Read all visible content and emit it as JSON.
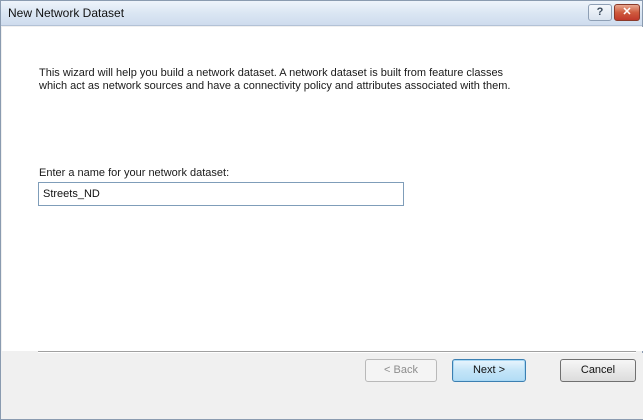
{
  "window": {
    "title": "New Network Dataset",
    "help_label": "?",
    "close_label": "✕"
  },
  "wizard": {
    "intro_text": "This wizard will help you build a network dataset.  A network dataset is built from feature classes which act as network sources and have a connectivity policy and attributes associated with them.",
    "name_label": "Enter a name for your network dataset:",
    "name_value": "Streets_ND"
  },
  "buttons": {
    "back_label": "< Back",
    "next_label": "Next >",
    "cancel_label": "Cancel"
  }
}
